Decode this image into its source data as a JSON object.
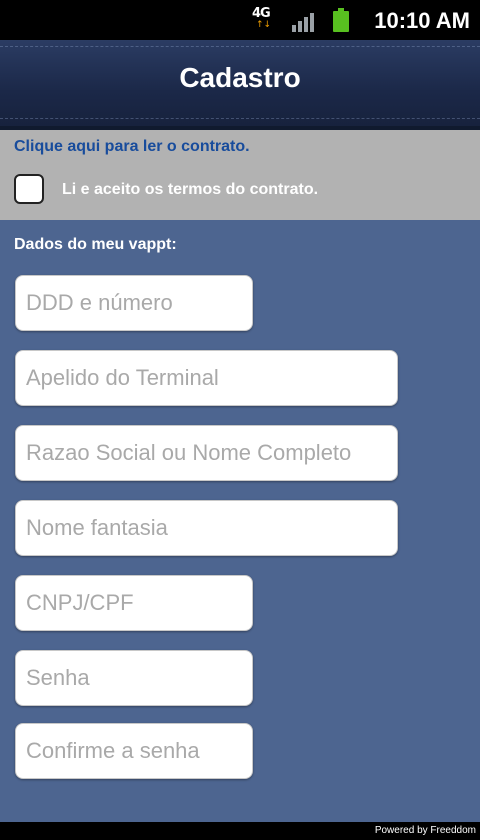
{
  "status_bar": {
    "network": "4G",
    "time": "10:10 AM",
    "icons": [
      "network-4g-icon",
      "signal-icon",
      "battery-icon"
    ]
  },
  "header": {
    "title": "Cadastro"
  },
  "terms": {
    "contract_link": "Clique aqui para ler o contrato.",
    "accept_label": "Li e aceito os termos do contrato.",
    "checked": false
  },
  "form": {
    "section_title": "Dados do meu vappt:",
    "fields": [
      {
        "placeholder": "DDD e número",
        "value": ""
      },
      {
        "placeholder": "Apelido do Terminal",
        "value": ""
      },
      {
        "placeholder": "Razao Social ou Nome Completo",
        "value": ""
      },
      {
        "placeholder": "Nome fantasia",
        "value": ""
      },
      {
        "placeholder": "CNPJ/CPF",
        "value": ""
      },
      {
        "placeholder": "Senha",
        "value": ""
      },
      {
        "placeholder": "Confirme a senha",
        "value": ""
      }
    ]
  },
  "footer": {
    "text": "Powered by Freeddom"
  },
  "colors": {
    "background": "#4d6590",
    "header": "#1b2848",
    "terms_panel": "#b2b2b2",
    "link": "#184c9c"
  }
}
